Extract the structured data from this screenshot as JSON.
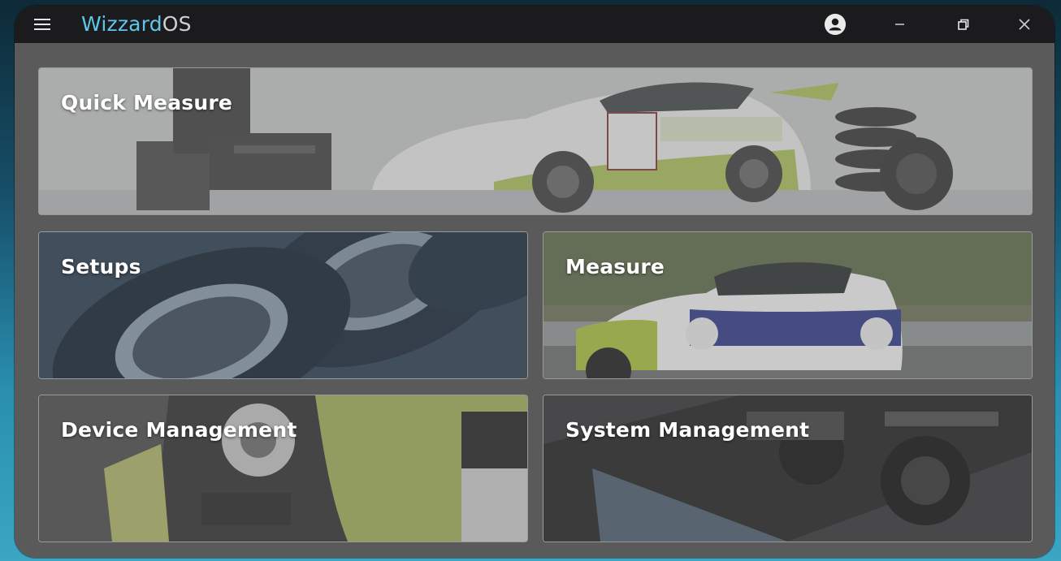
{
  "app": {
    "brand_part1": "Wizzard",
    "brand_part2": "OS",
    "brand_color": "#5ec6e8"
  },
  "titlebar": {
    "icons": {
      "menu": "hamburger-menu-icon",
      "account": "user-account-icon",
      "minimize": "minimize-icon",
      "restore": "restore-icon",
      "close": "close-icon"
    }
  },
  "tiles": [
    {
      "id": "quick-measure",
      "label": "Quick Measure"
    },
    {
      "id": "setups",
      "label": "Setups"
    },
    {
      "id": "measure",
      "label": "Measure"
    },
    {
      "id": "device-management",
      "label": "Device Management"
    },
    {
      "id": "system-management",
      "label": "System Management"
    }
  ]
}
